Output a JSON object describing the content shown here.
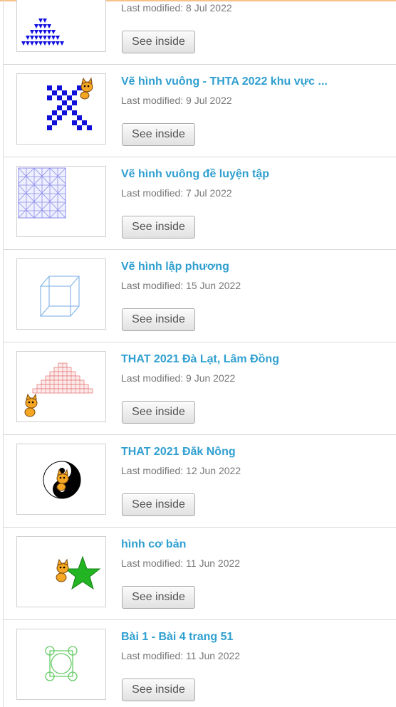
{
  "projects": [
    {
      "title": "",
      "modified": "Last modified: 8 Jul 2022",
      "button": "See inside",
      "thumbnail": "blue-triangle-pattern"
    },
    {
      "title": "Vẽ hình vuông - THTA 2022 khu vực ...",
      "modified": "Last modified: 9 Jul 2022",
      "button": "See inside",
      "thumbnail": "blue-checker-x-with-cat"
    },
    {
      "title": "Vẽ hình vuông đề luyện tập",
      "modified": "Last modified: 7 Jul 2022",
      "button": "See inside",
      "thumbnail": "blue-grid-lattice"
    },
    {
      "title": "Vẽ hình lập phương",
      "modified": "Last modified: 15 Jun 2022",
      "button": "See inside",
      "thumbnail": "wireframe-cube"
    },
    {
      "title": "THAT 2021 Đà Lạt, Lâm Đồng",
      "modified": "Last modified: 9 Jun 2022",
      "button": "See inside",
      "thumbnail": "red-grid-pyramid-with-cat"
    },
    {
      "title": "THAT 2021 Đắk Nông",
      "modified": "Last modified: 12 Jun 2022",
      "button": "See inside",
      "thumbnail": "yin-yang-with-cat"
    },
    {
      "title": "hình cơ bản",
      "modified": "Last modified: 11 Jun 2022",
      "button": "See inside",
      "thumbnail": "cat-and-green-star"
    },
    {
      "title": "Bài 1 - Bài 4 trang 51",
      "modified": "Last modified: 11 Jun 2022",
      "button": "See inside",
      "thumbnail": "green-circles-square"
    }
  ],
  "colors": {
    "title": "#2f9fd0",
    "meta": "#777777",
    "divider": "#d9d9d9",
    "top_accent": "#f5c38a"
  }
}
